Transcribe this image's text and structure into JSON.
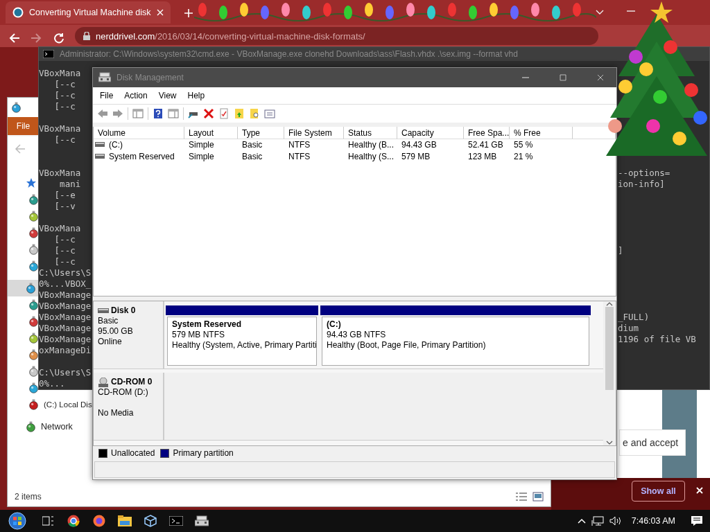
{
  "browser": {
    "tab": {
      "title": "Converting Virtual Machine disk",
      "selected": true
    },
    "url": "**nerddrivel.com**/2016/03/14/converting-virtual-machine-disk-formats/",
    "page_button": "e and accept",
    "downloads_button": "Show all"
  },
  "cmd": {
    "title": "Administrator: C:\\Windows\\system32\\cmd.exe - VBoxManage.exe  clonehd Downloads\\ass\\Flash.vhdx .\\sex.img --format vhd",
    "lines": [
      {
        "kind": "text",
        "left": "VBoxMana"
      },
      {
        "kind": "text",
        "left": "   [--c"
      },
      {
        "kind": "text",
        "left": "   [--c"
      },
      {
        "kind": "text",
        "left": "   [--c"
      },
      {
        "kind": "blank"
      },
      {
        "kind": "text",
        "left": "VBoxMana"
      },
      {
        "kind": "text",
        "left": "   [--c"
      },
      {
        "kind": "blank"
      },
      {
        "kind": "blank"
      },
      {
        "kind": "text",
        "left": "VBoxMana",
        "right": "--options="
      },
      {
        "kind": "text",
        "left": "    mani",
        "right": "ion-info]"
      },
      {
        "kind": "text",
        "left": "   [--e"
      },
      {
        "kind": "text",
        "left": "   [--v"
      },
      {
        "kind": "blank"
      },
      {
        "kind": "text",
        "left": "VBoxMana"
      },
      {
        "kind": "text",
        "left": "   [--c"
      },
      {
        "kind": "text",
        "left": "   [--c",
        "right": "]"
      },
      {
        "kind": "text",
        "left": "   [--c"
      },
      {
        "kind": "text",
        "left": "C:\\Users\\S"
      },
      {
        "kind": "text",
        "left": "0%...VBOX_"
      },
      {
        "kind": "text",
        "left": "VBoxManage"
      },
      {
        "kind": "text",
        "left": "VBoxManage"
      },
      {
        "kind": "text",
        "left": "VBoxManage",
        "right": "_FULL)"
      },
      {
        "kind": "text",
        "left": "VBoxManage",
        "right": "dium"
      },
      {
        "kind": "text",
        "left": "VBoxManage",
        "right": "1196 of file VB"
      },
      {
        "kind": "text",
        "left": "oxManageDi"
      },
      {
        "kind": "blank"
      },
      {
        "kind": "text",
        "left": "C:\\Users\\S"
      },
      {
        "kind": "text",
        "left": "0%..."
      }
    ]
  },
  "explorer": {
    "ribbon_tab": "File",
    "nav": [
      {
        "kind": "star",
        "selected": false,
        "children": [
          {
            "color": "#2a9d8f",
            "selected": false
          },
          {
            "color": "#a4c639",
            "selected": false
          },
          {
            "color": "#d23b3b",
            "selected": false
          },
          {
            "color": "#c8c8c8",
            "selected": false
          },
          {
            "color": "#2aa7d8",
            "selected": false
          }
        ]
      },
      {
        "kind": "ornament",
        "color": "#2a9fd6",
        "selected": true,
        "children": [
          {
            "color": "#2a9d8f",
            "selected": false
          },
          {
            "color": "#d23b3b",
            "selected": false
          },
          {
            "color": "#a4c639",
            "selected": false
          },
          {
            "color": "#e0904a",
            "selected": false
          },
          {
            "color": "#c8c8c8",
            "selected": false
          },
          {
            "color": "#2aa7d8",
            "selected": false
          },
          {
            "label": "(C:) Local Dis",
            "color": "#c41e1e",
            "selected": false
          }
        ]
      },
      {
        "kind": "ornament",
        "label": "Network",
        "color": "#3f9f3f",
        "selected": false
      }
    ],
    "status": "2 items"
  },
  "disk_management": {
    "title": "Disk Management",
    "menu": [
      "File",
      "Action",
      "View",
      "Help"
    ],
    "columns": [
      "Volume",
      "Layout",
      "Type",
      "File System",
      "Status",
      "Capacity",
      "Free Spa...",
      "% Free"
    ],
    "rows": [
      {
        "cells": [
          "(C:)",
          "Simple",
          "Basic",
          "NTFS",
          "Healthy (B...",
          "94.43 GB",
          "52.41 GB",
          "55 %"
        ]
      },
      {
        "cells": [
          "System Reserved",
          "Simple",
          "Basic",
          "NTFS",
          "Healthy (S...",
          "579 MB",
          "123 MB",
          "21 %"
        ]
      }
    ],
    "disks": [
      {
        "kind": "disk",
        "name": "Disk 0",
        "type": "Basic",
        "size": "95.00 GB",
        "status": "Online",
        "partitions": [
          {
            "name": "System Reserved",
            "size": "579 MB NTFS",
            "status": "Healthy (System, Active, Primary Partiti"
          },
          {
            "name": "(C:)",
            "size": "94.43 GB NTFS",
            "status": "Healthy (Boot, Page File, Primary Partition)"
          }
        ]
      },
      {
        "kind": "cdrom",
        "name": "CD-ROM 0",
        "type": "CD-ROM (D:)",
        "status": "No Media"
      }
    ],
    "legend": [
      {
        "label": "Unallocated",
        "color": "#000000"
      },
      {
        "label": "Primary partition",
        "color": "#000080"
      }
    ]
  },
  "taskbar": {
    "clock": "7:46:03 AM"
  }
}
